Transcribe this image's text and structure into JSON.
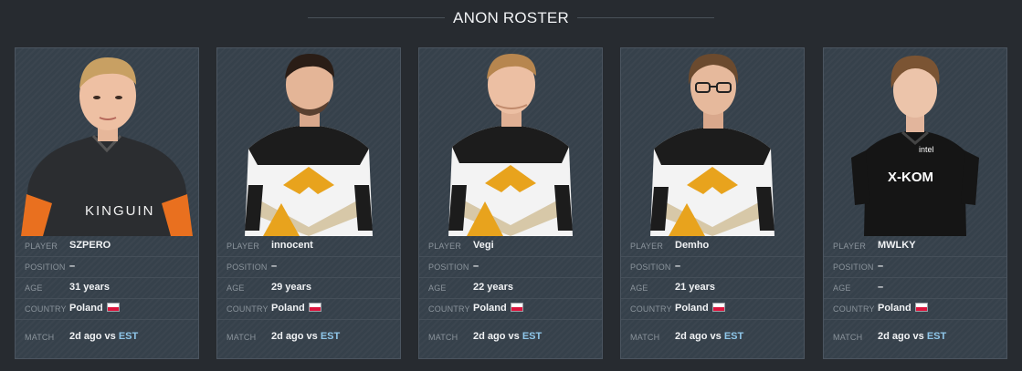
{
  "header": {
    "title": "ANON ROSTER"
  },
  "labels": {
    "player": "PLAYER",
    "position": "POSITION",
    "age": "AGE",
    "country": "COUNTRY",
    "match": "MATCH"
  },
  "players": [
    {
      "name": "SZPERO",
      "position": "–",
      "age": "31 years",
      "country": "Poland",
      "match_time": "2d ago vs",
      "match_opponent": "EST",
      "photo_icon": "player-photo-kinguin-jersey",
      "jersey_text": "KINGUIN"
    },
    {
      "name": "innocent",
      "position": "–",
      "age": "29 years",
      "country": "Poland",
      "match_time": "2d ago vs",
      "match_opponent": "EST",
      "photo_icon": "player-photo-gold-black-jersey",
      "jersey_text": ""
    },
    {
      "name": "Vegi",
      "position": "–",
      "age": "22 years",
      "country": "Poland",
      "match_time": "2d ago vs",
      "match_opponent": "EST",
      "photo_icon": "player-photo-gold-black-jersey",
      "jersey_text": ""
    },
    {
      "name": "Demho",
      "position": "–",
      "age": "21 years",
      "country": "Poland",
      "match_time": "2d ago vs",
      "match_opponent": "EST",
      "photo_icon": "player-photo-gold-black-jersey",
      "jersey_text": ""
    },
    {
      "name": "MWLKY",
      "position": "–",
      "age": "–",
      "country": "Poland",
      "match_time": "2d ago vs",
      "match_opponent": "EST",
      "photo_icon": "player-photo-xkom-jersey",
      "jersey_text": "X-KOM"
    }
  ],
  "colors": {
    "background": "#272b30",
    "card": "#36414b",
    "opponent_link": "#8fc7ea",
    "flag_white": "#ffffff",
    "flag_red": "#dc143c"
  }
}
